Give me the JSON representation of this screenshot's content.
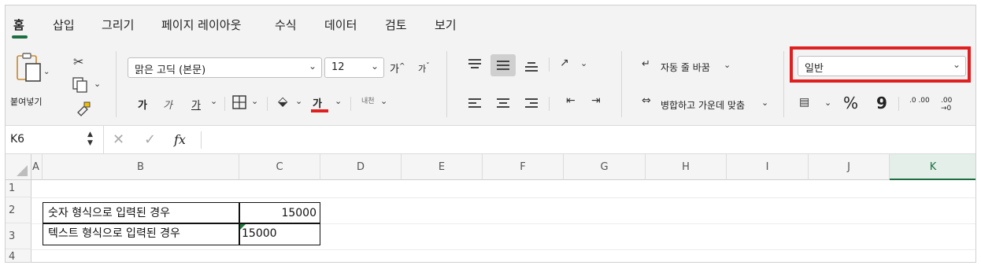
{
  "tabs": [
    "홈",
    "삽입",
    "그리기",
    "페이지 레이아웃",
    "수식",
    "데이터",
    "검토",
    "보기"
  ],
  "clipboard": {
    "paste_label": "붙여넣기"
  },
  "font": {
    "name": "맑은 고딕 (본문)",
    "size": "12",
    "grow_glyph": "가",
    "shrink_glyph": "가",
    "bold": "가",
    "italic": "가",
    "underline": "가",
    "font_color_glyph": "가",
    "phonetic_glyph": "내천"
  },
  "alignment": {
    "wrap_text": "자동 줄 바꿈",
    "merge_center": "병합하고 가운데 맞춤"
  },
  "number": {
    "format": "일반",
    "percent": "%",
    "comma": "9",
    "inc_decimal": ".0 .00",
    "dec_decimal": ".00 →0"
  },
  "formula_bar": {
    "name_box": "K6",
    "fx": "fx",
    "formula": ""
  },
  "columns": [
    "A",
    "B",
    "C",
    "D",
    "E",
    "F",
    "G",
    "H",
    "I",
    "J",
    "K"
  ],
  "active_column": "K",
  "rows": [
    "1",
    "2",
    "3",
    "4"
  ],
  "cells": {
    "B2": "숫자 형식으로 입력된 경우",
    "C2": "15000",
    "B3": "텍스트 형식으로 입력된 경우",
    "C3": "15000"
  },
  "colors": {
    "accent": "#1d6f42",
    "highlight": "#e02020",
    "font_color_bar": "#e02020"
  }
}
